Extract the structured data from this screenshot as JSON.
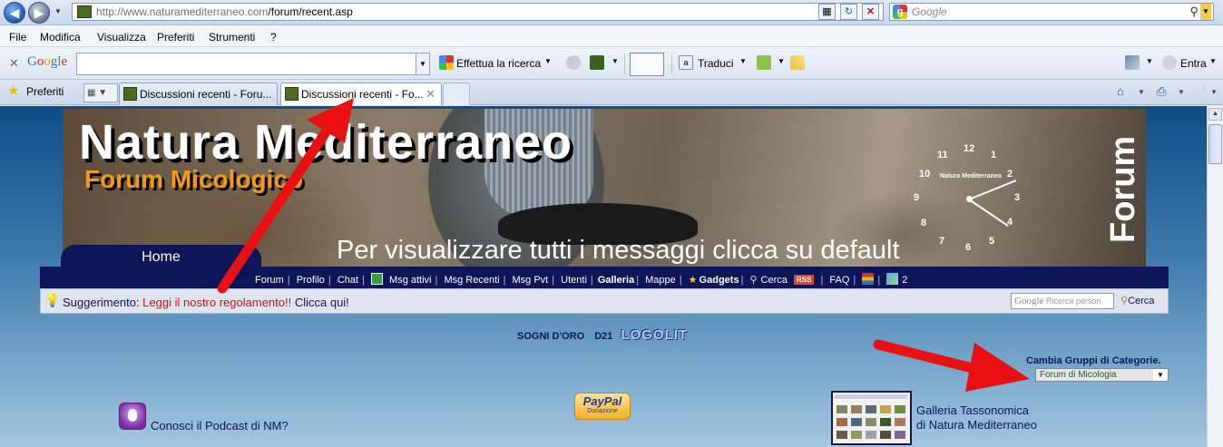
{
  "browser": {
    "url": "http://www.naturamediterraneo.com/forum/recent.asp",
    "url_host": "http://www.naturamediterraneo.com",
    "url_path": "/forum/recent.asp",
    "search_placeholder": "Google",
    "menu": [
      "File",
      "Modifica",
      "Visualizza",
      "Preferiti",
      "Strumenti",
      "?"
    ],
    "google_toolbar": {
      "logo": "Google",
      "search_button": "Effettua la ricerca",
      "translate": "Traduci",
      "signin": "Entra"
    },
    "favorites_label": "Preferiti",
    "tabs": [
      {
        "title": "Discussioni recenti - Foru...",
        "active": false
      },
      {
        "title": "Discussioni recenti - Fo...",
        "active": true
      }
    ]
  },
  "banner": {
    "title": "Natura Mediterraneo",
    "subtitle": "Forum Micologico",
    "hint": "Per visualizzare tutti i messaggi clicca su default",
    "side_label": "Forum",
    "clock_label": "Natura Mediterraneo",
    "clock_numbers": [
      "12",
      "1",
      "2",
      "3",
      "4",
      "5",
      "6",
      "7",
      "8",
      "9",
      "10",
      "11"
    ]
  },
  "nav": {
    "home": "Home",
    "links": [
      "Forum",
      "Profilo",
      "Chat",
      "Msg attivi",
      "Msg Recenti",
      "Msg Pvt",
      "Utenti",
      "Galleria",
      "Mappe",
      "Gadgets",
      "Cerca",
      "RSS",
      "FAQ",
      "2"
    ]
  },
  "tip": {
    "prefix": "Suggerimento: ",
    "link": "Leggi il nostro regolamento!!",
    "suffix": " Clicca qui!",
    "search_brand": "Google",
    "search_placeholder": "Ricerca person",
    "search_button": "Cerca"
  },
  "center": {
    "link1": "SOGNI D'ORO",
    "link2": "D21",
    "logo": "LOGOLIT"
  },
  "categories": {
    "label": "Cambia Gruppi di Categorie.",
    "selected": "Forum di Micologia"
  },
  "footer_links": {
    "podcast": "Conosci il Podcast di NM?",
    "paypal": "PayPal",
    "paypal_sub": "Donazione",
    "gallery_line1": "Galleria Tassonomica",
    "gallery_line2": "di Natura Mediterraneo"
  },
  "colors": {
    "nav_bg": "#0c1558",
    "subtitle": "#f39a12",
    "arrow": "#e81010",
    "tip_link": "#d01010"
  }
}
